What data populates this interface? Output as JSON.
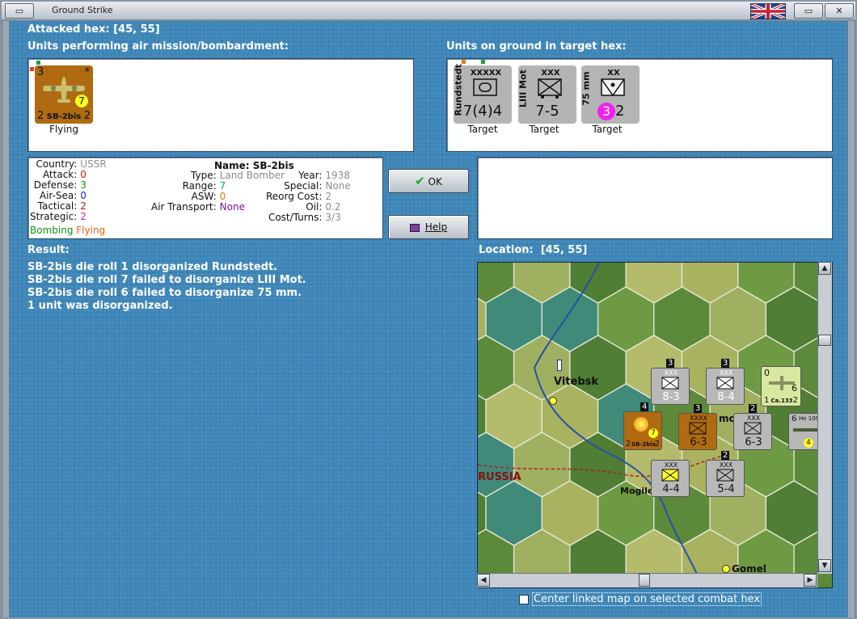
{
  "window": {
    "title": "Ground Strike",
    "attacked_hex_label": "Attacked hex:",
    "attacked_hex_value": "[45, 55]"
  },
  "air_units": {
    "header": "Units performing air mission/bombardment:",
    "items": [
      {
        "top_left": "3",
        "corner": "*",
        "circle": "7",
        "bottom_left": "2",
        "bottom_right": "2",
        "name": "SB-2bis",
        "status": "Flying",
        "color": "#b06a10"
      }
    ]
  },
  "ground_units": {
    "header": "Units on ground in target hex:",
    "items": [
      {
        "side": "Rundstedt",
        "size": "XXXXX",
        "strength": "7(4)4",
        "status": "Target"
      },
      {
        "side": "LIII Mot",
        "size": "XXX",
        "strength": "7-5",
        "status": "Target"
      },
      {
        "side": "75 mm",
        "size": "XX",
        "circle": "3",
        "strength": "2",
        "status": "Target"
      }
    ]
  },
  "info": {
    "left": [
      {
        "key": "Country:",
        "value": "USSR",
        "color": "#8a8a8a"
      },
      {
        "key": "Attack:",
        "value": "0",
        "color": "#e01010"
      },
      {
        "key": "Defense:",
        "value": "3",
        "color": "#109010"
      },
      {
        "key": "Air-Sea:",
        "value": "0",
        "color": "#2020c0"
      },
      {
        "key": "Tactical:",
        "value": "2",
        "color": "#c01010"
      },
      {
        "key": "Strategic:",
        "value": "2",
        "color": "#c020c0"
      }
    ],
    "mission_a": "Bombing",
    "mission_b": "Flying",
    "name_label": "Name:",
    "name_value": "SB-2bis",
    "mid": [
      {
        "key": "Type:",
        "value": "Land Bomber",
        "color": "#8a8a8a"
      },
      {
        "key": "Range:",
        "value": "7",
        "color": "#10a0a0"
      },
      {
        "key": "ASW:",
        "value": "0",
        "color": "#e08000"
      },
      {
        "key": "Air Transport:",
        "value": "None",
        "color": "#8010a0"
      }
    ],
    "right": [
      {
        "key": "Year:",
        "value": "1938"
      },
      {
        "key": "Special:",
        "value": "None"
      },
      {
        "key": "Reorg Cost:",
        "value": "2"
      },
      {
        "key": "Oil:",
        "value": "0.2"
      },
      {
        "key": "Cost/Turns:",
        "value": "3/3"
      }
    ]
  },
  "buttons": {
    "ok": "OK",
    "help": "Help"
  },
  "result": {
    "label": "Result:",
    "lines": [
      "SB-2bis die roll 1 disorganized Rundstedt.",
      "SB-2bis die roll 7 failed to disorganize LIII Mot.",
      "SB-2bis die roll 6 failed to disorganize 75 mm.",
      "1 unit was disorganized."
    ]
  },
  "location": {
    "label": "Location:",
    "value": "[45, 55]"
  },
  "map": {
    "cities": [
      "Vitebsk",
      "Mogile",
      "Gomel",
      "mo"
    ],
    "region": "RUSSIA",
    "units": [
      {
        "id": "u1",
        "top": "3",
        "size": "XXX",
        "strength": "8-3",
        "color": "#b8b8b8"
      },
      {
        "id": "u2",
        "top": "3",
        "size": "XXX",
        "strength": "8-4",
        "color": "#b8b8b8"
      },
      {
        "id": "u3",
        "top": "0",
        "circle": "6",
        "bottom": "1",
        "name": "Ca.133",
        "bottom_right": "2",
        "color": "#d8e8a0"
      },
      {
        "id": "u4",
        "top": "4",
        "circle": "7",
        "bottom": "2",
        "name": "SB-2bis",
        "bottom_right": "2",
        "color": "#b06a10"
      },
      {
        "id": "u5",
        "top": "3",
        "size": "XXXX",
        "strength": "6-3",
        "color": "#b06a10"
      },
      {
        "id": "u6",
        "top": "2",
        "size": "XXX",
        "strength": "6-3",
        "color": "#b8b8b8"
      },
      {
        "id": "u7",
        "top": "6",
        "name": "He 100",
        "circle": "4",
        "color": "#b8b8b8"
      },
      {
        "id": "u8",
        "size": "XXX",
        "strength": "4-4",
        "color": "#b8b8b8"
      },
      {
        "id": "u9",
        "top": "2",
        "size": "XXX",
        "strength": "5-4",
        "color": "#b8b8b8"
      }
    ]
  },
  "checkbox_label": "Center linked map on selected combat hex"
}
